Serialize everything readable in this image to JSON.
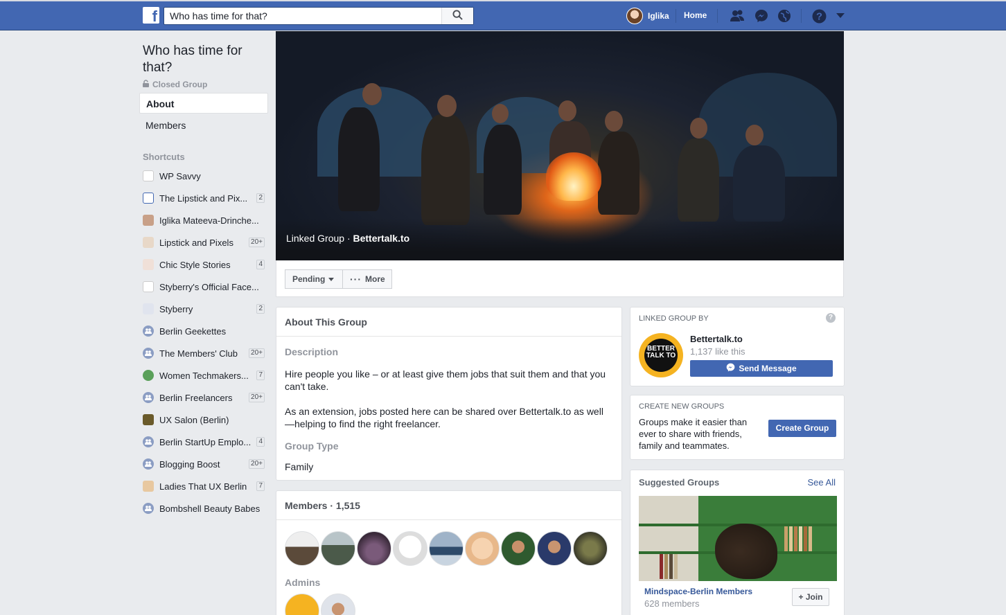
{
  "topbar": {
    "logo": "f",
    "search_value": "Who has time for that?",
    "user_name": "Iglika",
    "home_label": "Home",
    "icons": [
      "friends-icon",
      "messenger-icon",
      "notifications-icon",
      "help-icon",
      "chevron-down-icon"
    ]
  },
  "group": {
    "title": "Who has time for that?",
    "privacy": "Closed Group",
    "nav": {
      "about": "About",
      "members": "Members"
    }
  },
  "shortcuts": {
    "heading": "Shortcuts",
    "items": [
      {
        "label": "WP Savvy",
        "count": ""
      },
      {
        "label": "The Lipstick and Pix...",
        "count": "2"
      },
      {
        "label": "Iglika Mateeva-Drinche...",
        "count": ""
      },
      {
        "label": "Lipstick and Pixels",
        "count": "20+"
      },
      {
        "label": "Chic Style Stories",
        "count": "4"
      },
      {
        "label": "Styberry's Official Face...",
        "count": ""
      },
      {
        "label": "Styberry",
        "count": "2"
      },
      {
        "label": "Berlin Geekettes",
        "count": ""
      },
      {
        "label": "The Members' Club",
        "count": "20+"
      },
      {
        "label": "Women Techmakers...",
        "count": "7"
      },
      {
        "label": "Berlin Freelancers",
        "count": "20+"
      },
      {
        "label": "UX Salon (Berlin)",
        "count": ""
      },
      {
        "label": "Berlin StartUp Emplo...",
        "count": "4"
      },
      {
        "label": "Blogging Boost",
        "count": "20+"
      },
      {
        "label": "Ladies That UX Berlin",
        "count": "7"
      },
      {
        "label": "Bombshell Beauty Babes",
        "count": ""
      }
    ]
  },
  "cover": {
    "prefix": "Linked Group · ",
    "link": "Bettertalk.to"
  },
  "actions": {
    "pending": "Pending",
    "more": "More"
  },
  "about": {
    "heading": "About This Group",
    "description_label": "Description",
    "description_1": "Hire people you like – or at least give them jobs that suit them and that you can't take.",
    "description_2": "As an extension, jobs posted here can be shared over Bettertalk.to as well—helping to find the right freelancer.",
    "type_label": "Group Type",
    "type_value": "Family"
  },
  "members": {
    "heading": "Members · 1,515",
    "admins_label": "Admins"
  },
  "linked": {
    "heading": "LINKED GROUP BY",
    "page_name": "Bettertalk.to",
    "likes": "1,137 like this",
    "send_label": "Send Message",
    "logo_text": "BETTER TALK TO"
  },
  "create": {
    "heading": "CREATE NEW GROUPS",
    "text": "Groups make it easier than ever to share with friends, family and teammates.",
    "button": "Create Group"
  },
  "suggested": {
    "heading": "Suggested Groups",
    "see_all": "See All",
    "group_name": "Mindspace-Berlin Members",
    "group_members": "628 members",
    "join": "+ Join"
  },
  "colors": {
    "brand": "#4267b2",
    "background": "#e9ebee",
    "muted": "#90949c"
  }
}
